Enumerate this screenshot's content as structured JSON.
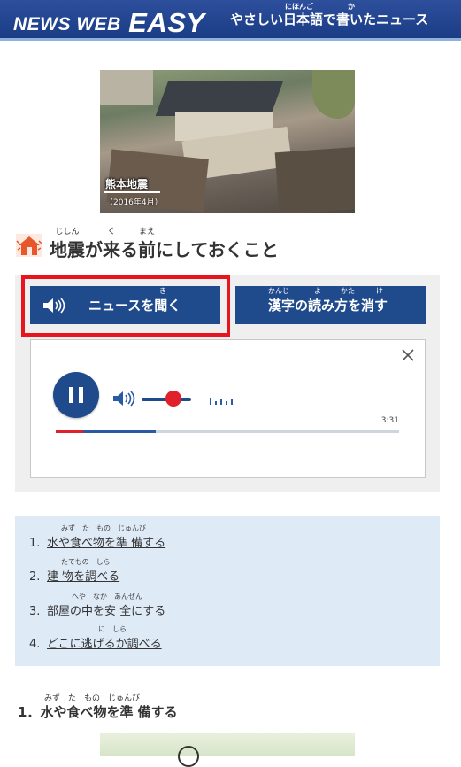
{
  "header": {
    "logo_text": "NEWS WEB",
    "logo_easy": "EASY",
    "subtitle": "やさしい日本語で書いたニュース",
    "subtitle_ruby_nihongo": "にほんご",
    "subtitle_ruby_ka": "か",
    "bg_color": "#1f4a8c"
  },
  "photo": {
    "caption_title": "熊本地震",
    "caption_date": "（2016年4月）"
  },
  "article": {
    "icon": "disaster-house-icon",
    "title_parts": [
      {
        "text": "地震",
        "ruby": "じしん"
      },
      {
        "text": "が",
        "ruby": ""
      },
      {
        "text": "来",
        "ruby": "く"
      },
      {
        "text": "る",
        "ruby": ""
      },
      {
        "text": "前",
        "ruby": "まえ"
      },
      {
        "text": "にしておくこと",
        "ruby": ""
      }
    ]
  },
  "audio": {
    "listen_label": "ニュースを聞く",
    "listen_ruby": "き",
    "kanji_toggle_label": "漢字の読み方を消す",
    "kanji_ruby": [
      "かんじ",
      "よ",
      "かた",
      "け"
    ],
    "duration": "3:31",
    "progress_played": 0.08,
    "progress_buffered": 0.29,
    "volume": 0.55,
    "highlight_color": "#e8141e"
  },
  "outline": {
    "items": [
      {
        "num": "1.",
        "text": "水や食べ物を準 備する",
        "ruby": "みず　た　もの　じゅんび"
      },
      {
        "num": "2.",
        "text": "建 物を調べる",
        "ruby": "たてもの　しら"
      },
      {
        "num": "3.",
        "text": "部屋の中を安 全にする",
        "ruby": "へや　なか　あんぜん"
      },
      {
        "num": "4.",
        "text": "どこに逃げるか調べる",
        "ruby": "に　しら"
      }
    ]
  },
  "section": {
    "num": "1．",
    "title": "水や食べ物を準 備する",
    "ruby": "みず　た　もの　じゅんび"
  }
}
